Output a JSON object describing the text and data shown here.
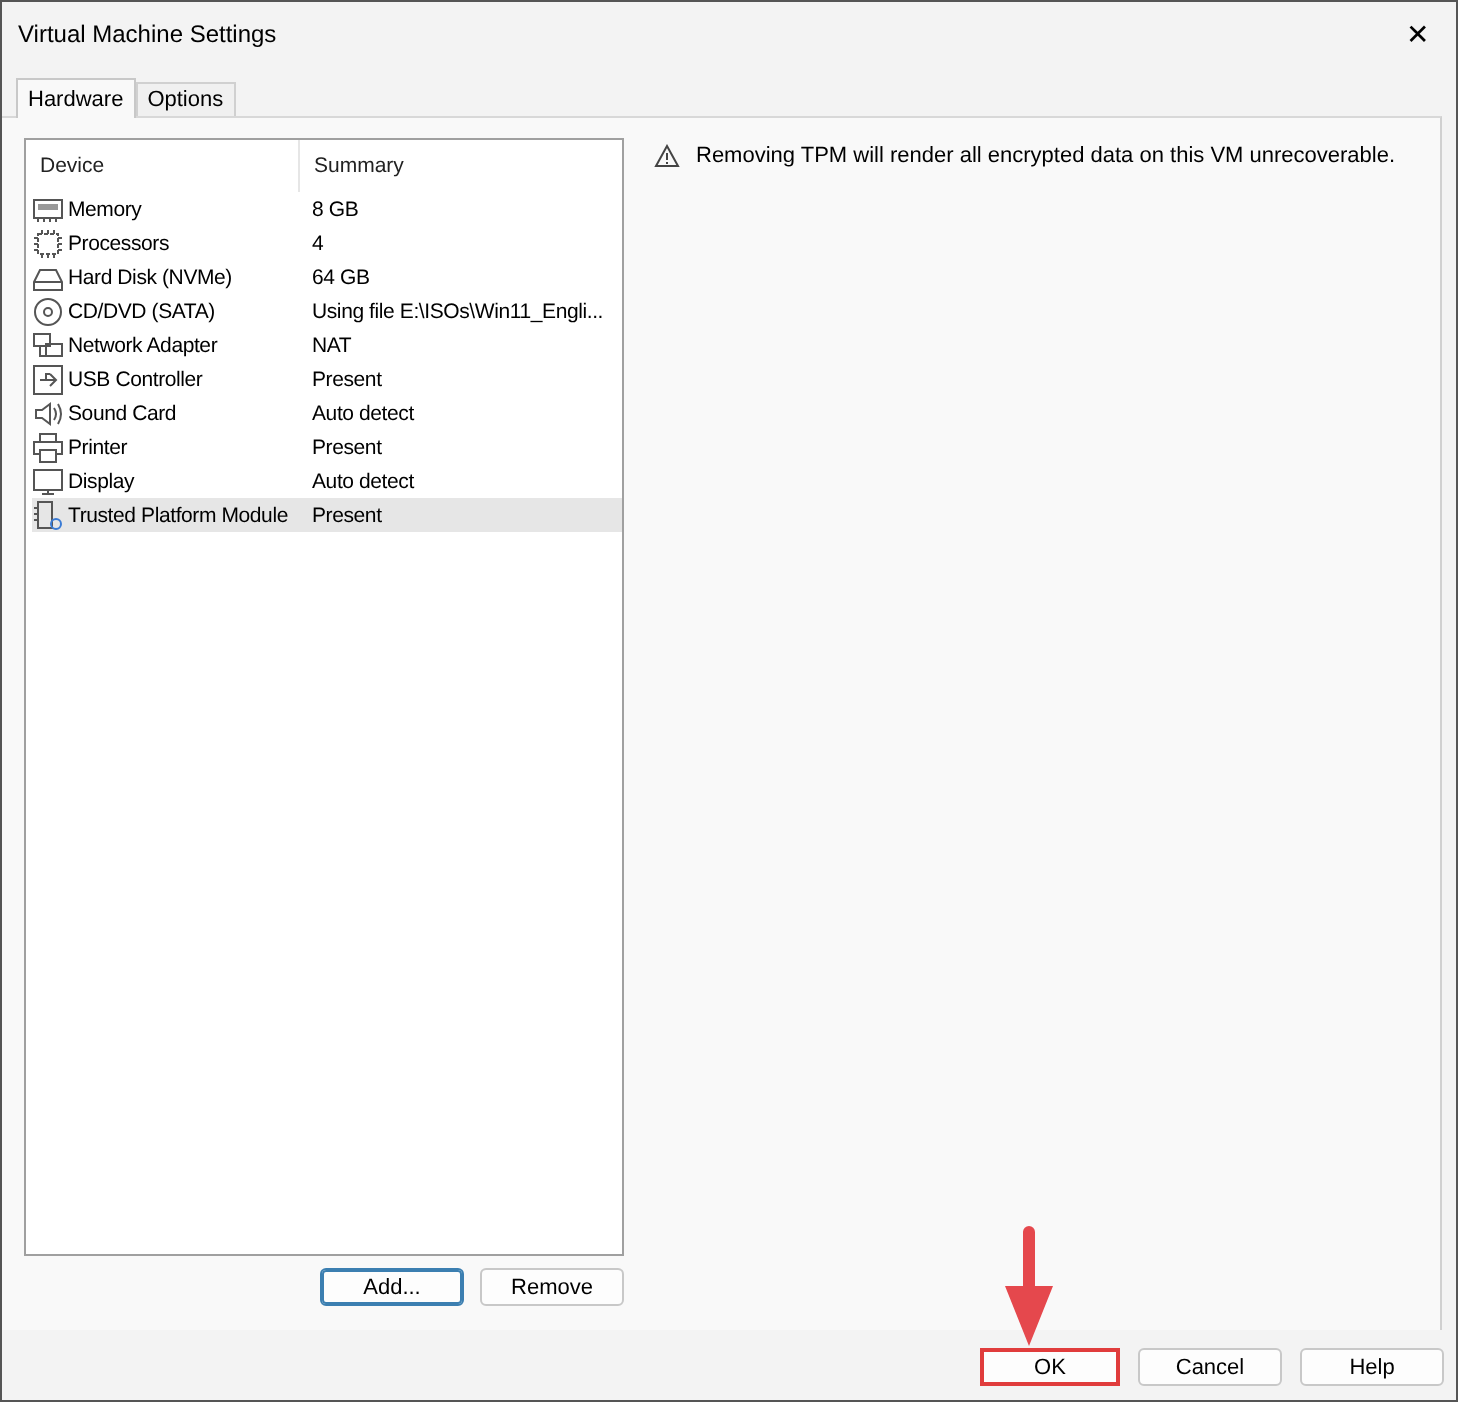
{
  "window": {
    "title": "Virtual Machine Settings",
    "close": "✕"
  },
  "tabs": [
    {
      "label": "Hardware",
      "selected": true
    },
    {
      "label": "Options",
      "selected": false
    }
  ],
  "device_table": {
    "columns": [
      "Device",
      "Summary"
    ],
    "rows": [
      {
        "kind": "memory",
        "device": "Memory",
        "summary": "8 GB",
        "selected": false
      },
      {
        "kind": "cpu",
        "device": "Processors",
        "summary": "4",
        "selected": false
      },
      {
        "kind": "disk",
        "device": "Hard Disk (NVMe)",
        "summary": "64 GB",
        "selected": false
      },
      {
        "kind": "disc",
        "device": "CD/DVD (SATA)",
        "summary": "Using file E:\\ISOs\\Win11_Engli...",
        "selected": false
      },
      {
        "kind": "network",
        "device": "Network Adapter",
        "summary": "NAT",
        "selected": false
      },
      {
        "kind": "usb",
        "device": "USB Controller",
        "summary": "Present",
        "selected": false
      },
      {
        "kind": "sound",
        "device": "Sound Card",
        "summary": "Auto detect",
        "selected": false
      },
      {
        "kind": "printer",
        "device": "Printer",
        "summary": "Present",
        "selected": false
      },
      {
        "kind": "display",
        "device": "Display",
        "summary": "Auto detect",
        "selected": false
      },
      {
        "kind": "tpm",
        "device": "Trusted Platform Module",
        "summary": "Present",
        "selected": true
      }
    ]
  },
  "list_buttons": [
    {
      "label": "Add...",
      "focused": true
    },
    {
      "label": "Remove",
      "focused": false
    }
  ],
  "warning": "Removing TPM will render all encrypted data on this VM unrecoverable.",
  "footer_buttons": [
    {
      "label": "OK",
      "highlighted": true
    },
    {
      "label": "Cancel",
      "highlighted": false
    },
    {
      "label": "Help",
      "highlighted": false
    }
  ]
}
